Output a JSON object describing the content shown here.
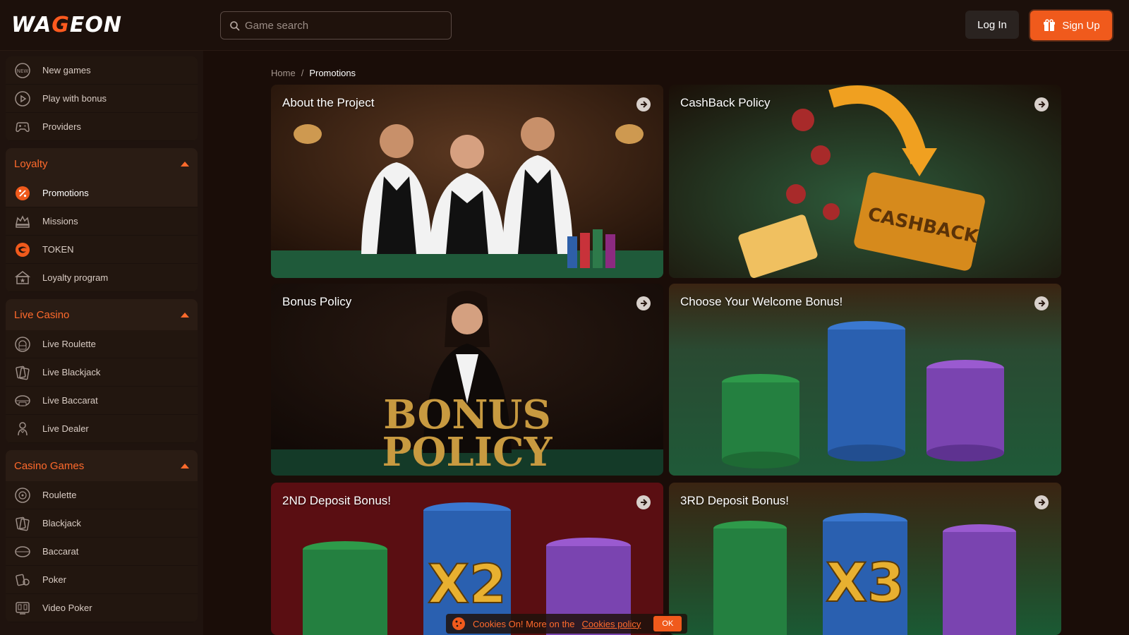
{
  "header": {
    "logo": "WAGEON",
    "search_placeholder": "Game search",
    "login_label": "Log In",
    "signup_label": "Sign Up"
  },
  "sidebar": {
    "top_items": [
      {
        "label": "New games",
        "icon": "new-badge-icon"
      },
      {
        "label": "Play with bonus",
        "icon": "play-circle-icon"
      },
      {
        "label": "Providers",
        "icon": "gamepad-icon"
      }
    ],
    "loyalty": {
      "title": "Loyalty",
      "items": [
        {
          "label": "Promotions",
          "icon": "percent-badge-icon"
        },
        {
          "label": "Missions",
          "icon": "crown-icon"
        },
        {
          "label": "TOKEN",
          "icon": "token-icon"
        },
        {
          "label": "Loyalty program",
          "icon": "building-star-icon"
        }
      ]
    },
    "live_casino": {
      "title": "Live Casino",
      "items": [
        {
          "label": "Live Roulette",
          "icon": "live-roulette-icon"
        },
        {
          "label": "Live Blackjack",
          "icon": "live-blackjack-icon"
        },
        {
          "label": "Live Baccarat",
          "icon": "live-baccarat-icon"
        },
        {
          "label": "Live Dealer",
          "icon": "dealer-icon"
        }
      ]
    },
    "casino_games": {
      "title": "Casino Games",
      "items": [
        {
          "label": "Roulette",
          "icon": "roulette-icon"
        },
        {
          "label": "Blackjack",
          "icon": "cards-icon"
        },
        {
          "label": "Baccarat",
          "icon": "baccarat-icon"
        },
        {
          "label": "Poker",
          "icon": "poker-icon"
        },
        {
          "label": "Video Poker",
          "icon": "video-poker-icon"
        }
      ]
    }
  },
  "breadcrumb": {
    "home": "Home",
    "separator": "/",
    "current": "Promotions"
  },
  "promotions": [
    {
      "title": "About the Project",
      "image_text": ""
    },
    {
      "title": "CashBack Policy",
      "image_text": "CASHBACK"
    },
    {
      "title": "Bonus Policy",
      "image_text_1": "BONUS",
      "image_text_2": "POLICY"
    },
    {
      "title": "Choose Your Welcome Bonus!",
      "image_text": ""
    },
    {
      "title": "2ND Deposit Bonus!",
      "image_text": "X2"
    },
    {
      "title": "3RD Deposit Bonus!",
      "image_text": "X3"
    }
  ],
  "cookie": {
    "text": "Cookies On! More on the",
    "link": "Cookies policy",
    "ok": "OK"
  },
  "colors": {
    "accent": "#f05a1c",
    "background": "#1a0d08",
    "sidebar": "#1f130e"
  }
}
